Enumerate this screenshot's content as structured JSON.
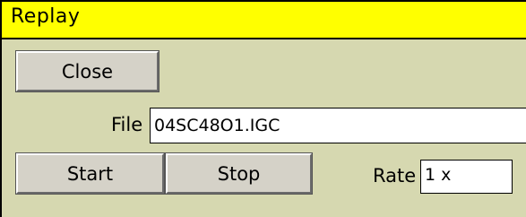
{
  "window": {
    "title": "Replay"
  },
  "buttons": {
    "close": "Close",
    "start": "Start",
    "stop": "Stop"
  },
  "file": {
    "label": "File",
    "value": "04SC48O1.IGC"
  },
  "rate": {
    "label": "Rate",
    "value": "1 x"
  },
  "colors": {
    "titlebar": "#ffff00",
    "background": "#d6d8b0",
    "button": "#d5d2c8"
  }
}
